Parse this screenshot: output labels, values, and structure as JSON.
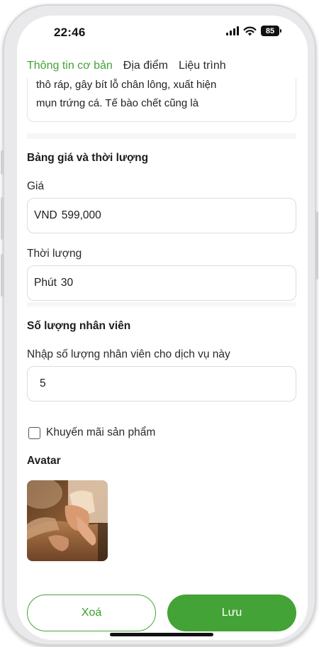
{
  "status_bar": {
    "time": "22:46",
    "battery": "85"
  },
  "tabs": [
    {
      "label": "Thông tin cơ bản",
      "active": true
    },
    {
      "label": "Địa điểm",
      "active": false
    },
    {
      "label": "Liệu trình",
      "active": false
    }
  ],
  "description": {
    "line1": "thô ráp, gây bít lỗ chân lông, xuất hiện",
    "line2": "mụn trứng cá. Tế bào chết cũng là"
  },
  "pricing": {
    "section_title": "Bảng giá và thời lượng",
    "price_label": "Giá",
    "price_unit": "VND",
    "price_value": "599,000",
    "duration_label": "Thời lượng",
    "duration_unit": "Phút",
    "duration_value": "30"
  },
  "staff": {
    "section_title": "Số lượng nhân viên",
    "field_label": "Nhập số lượng nhân viên cho dịch vụ này",
    "value": "5"
  },
  "promotion": {
    "label": "Khuyến mãi sản phẩm",
    "checked": false
  },
  "avatar": {
    "title": "Avatar"
  },
  "actions": {
    "delete_label": "Xoá",
    "save_label": "Lưu"
  },
  "colors": {
    "accent": "#43a336",
    "border": "#dcdcdc"
  }
}
